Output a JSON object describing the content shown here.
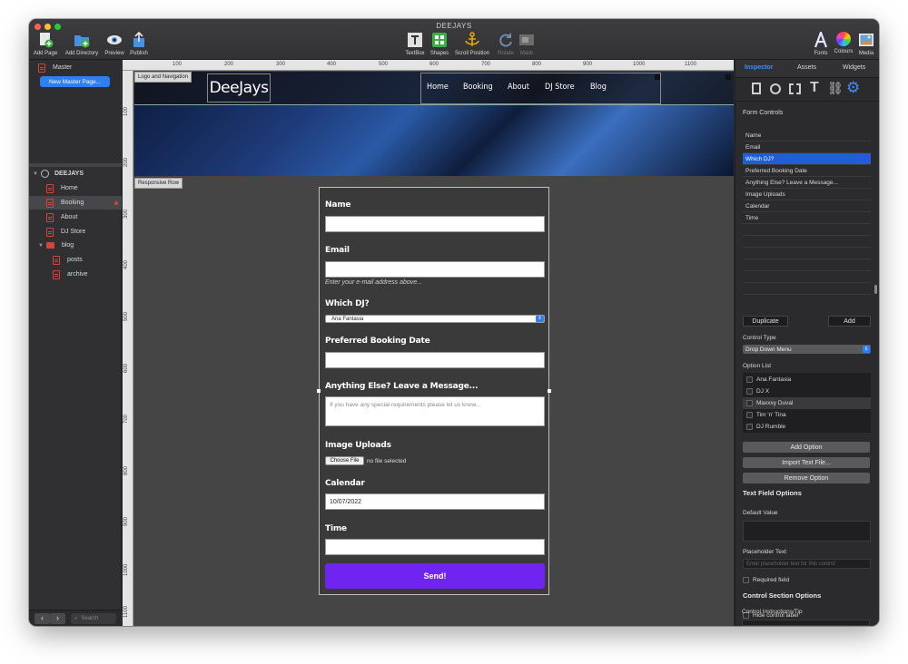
{
  "window": {
    "title": "DEEJAYS"
  },
  "toolbar": {
    "left": [
      {
        "label": "Add Page",
        "icon": "add-page-icon"
      },
      {
        "label": "Add Directory",
        "icon": "add-directory-icon"
      },
      {
        "label": "Preview",
        "icon": "eye-icon"
      },
      {
        "label": "Publish",
        "icon": "publish-icon"
      }
    ],
    "center": [
      {
        "label": "TextBox",
        "icon": "textbox-icon"
      },
      {
        "label": "Shapes",
        "icon": "shapes-icon"
      },
      {
        "label": "Scroll Position",
        "icon": "anchor-icon"
      },
      {
        "label": "Rotate",
        "icon": "rotate-icon"
      },
      {
        "label": "Mask",
        "icon": "mask-icon"
      }
    ],
    "right": [
      {
        "label": "Fonts",
        "icon": "fonts-icon"
      },
      {
        "label": "Colours",
        "icon": "colours-icon"
      },
      {
        "label": "Media",
        "icon": "media-icon"
      }
    ]
  },
  "sidebar": {
    "master_label": "Master",
    "new_master_button": "New Master Page...",
    "site_name": "DEEJAYS",
    "pages": [
      "Home",
      "Booking",
      "About",
      "DJ Store"
    ],
    "folder": "blog",
    "subpages": [
      "posts",
      "archive"
    ],
    "search_placeholder": "Search"
  },
  "rulers": {
    "h": [
      "100",
      "200",
      "300",
      "400",
      "500",
      "600",
      "700",
      "800",
      "900",
      "1000",
      "1100"
    ],
    "v": [
      "100",
      "200",
      "300",
      "400",
      "500",
      "600",
      "700",
      "800",
      "900",
      "1000",
      "1100"
    ]
  },
  "site": {
    "logo_tag": "Logo and Navigation",
    "logo": "DeeJays",
    "nav": [
      "Home",
      "Booking",
      "About",
      "DJ Store",
      "Blog"
    ],
    "row_tag": "Responsive Row"
  },
  "form": {
    "name_label": "Name",
    "email_label": "Email",
    "email_hint": "Enter your e-mail address above...",
    "dj_label": "Which DJ?",
    "dj_value": "Ana Fantasia",
    "date_label": "Preferred Booking Date",
    "message_label": "Anything Else? Leave a Message...",
    "message_placeholder": "If you have any special requirements please let us know...",
    "uploads_label": "Image Uploads",
    "choose_file": "Choose File",
    "no_file": "no file selected",
    "calendar_label": "Calendar",
    "calendar_value": "10/07/2022",
    "time_label": "Time",
    "send": "Send!"
  },
  "inspector": {
    "tabs": [
      "Inspector",
      "Assets",
      "Widgets"
    ],
    "section_title": "Form Controls",
    "controls": [
      "Name",
      "Email",
      "Which DJ?",
      "Preferred Booking Date",
      "Anything Else? Leave a Message...",
      "Image Uploads",
      "Calendar",
      "Time"
    ],
    "duplicate": "Duplicate",
    "add": "Add",
    "control_type_label": "Control Type",
    "control_type_value": "Drop Down Menu",
    "option_list_label": "Option List",
    "options": [
      "Ana Fantasia",
      "DJ X",
      "Maxxxy Duval",
      "Tim 'n' Tina",
      "DJ Rumble"
    ],
    "add_option": "Add Option",
    "import_text": "Import Text File...",
    "remove_option": "Remove Option",
    "text_field_options": "Text Field Options",
    "default_value_label": "Default Value",
    "placeholder_label": "Placeholder Text",
    "placeholder_hint": "Enter placeholder text for this control",
    "required_field": "Required field",
    "control_section_options": "Control Section Options",
    "hide_label": "Hide control label",
    "instructions_label": "Control Instructions/Tip"
  },
  "colors": {
    "accent": "#7024f0",
    "selection": "#1f5ed6",
    "page_icon": "#d0463b"
  }
}
